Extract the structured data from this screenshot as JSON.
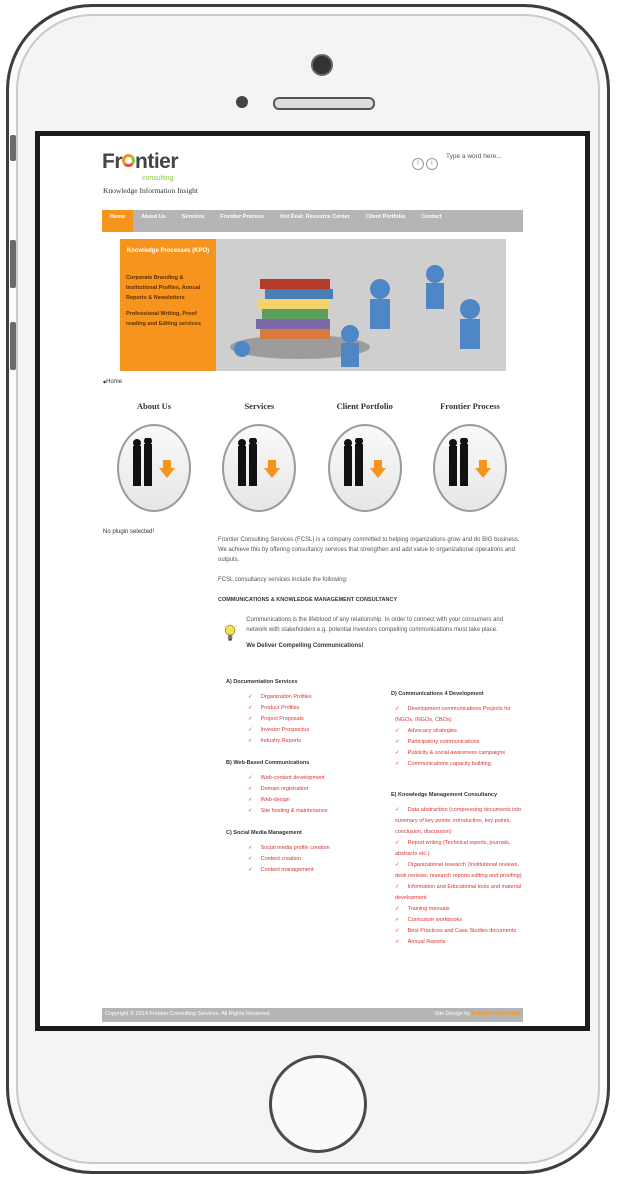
{
  "site": {
    "logo_main": "Fr",
    "logo_main_rest": "ntier",
    "logo_sub": "consulting",
    "tagline": "Knowledge Information Insight",
    "search_placeholder": "Type a word here..."
  },
  "nav": [
    "Home",
    "About Us",
    "Services",
    "Frontier Process",
    "Hot Deal: Resource Center",
    "Client Portfolio",
    "Contact"
  ],
  "banner": {
    "title": "Knowledge Processes (KPO)",
    "text1": "Corporate Branding & Institutional Profiles, Annual Reports & Newsletters",
    "text2": "Professional Writing, Proof reading and Editing services"
  },
  "breadcrumb": "Home",
  "columns": [
    {
      "title": "About Us"
    },
    {
      "title": "Services"
    },
    {
      "title": "Client Portfolio"
    },
    {
      "title": "Frontier Process"
    }
  ],
  "no_plugin": "No plugin selected!",
  "content": {
    "p1": "Frontier Consulting Services (FCSL) is a company committed to helping organizations grow and do BIG business. We achieve this by offering consultancy services that strengthen and add value to organizational operations and outputs.",
    "p2": "FCSL consultancy services include the following:",
    "heading": "COMMUNICATIONS & KNOWLEDGE MANAGEMENT CONSULTANCY",
    "p3": "Communications is the lifeblood of any relationship. In order to connect with your consumers and network with stakeholders e.g. potential investors compelling communications must take place.",
    "deliver": "We Deliver Compelling Communications!"
  },
  "sections_left": [
    {
      "heading": "A) Documentation Services",
      "items": [
        "Organization Profiles",
        "Product Profiles",
        "Project Proposals",
        "Investor Prospectus",
        "Industry Reports"
      ]
    },
    {
      "heading": "B) Web-Based Communications",
      "items": [
        "Web-content development",
        "Domain registration",
        "Web-design",
        "Site hosting & maintenance"
      ]
    },
    {
      "heading": "C) Social Media Management",
      "items": [
        "Social media profile creation",
        "Content creation",
        "Content management"
      ]
    }
  ],
  "sections_right": [
    {
      "heading": "D) Communications 4 Development",
      "items": [
        "Development communications Projects for (NGOs, INGOs, CBOs)",
        "Advocacy strategies",
        "Participatory communications",
        "Publicity & social awareness campaigns",
        "Communications capacity building."
      ]
    },
    {
      "heading": "E) Knowledge Management Consultancy",
      "items": [
        "Data abstraction (compressing documents into summary of key points: introduction, key points, conclusion, discussion)",
        "Report writing (Technical reports, journals, abstracts etc.)",
        "Organizational research (Institutional reviews, desk reviews, research reports editing and proofing)",
        "Information and Educational tools and material development",
        "Training manuals",
        "Curriculum workbooks",
        "Best Practices and Case Studies documents",
        "Annual Reports"
      ]
    }
  ],
  "footer": {
    "left": "Copyright © 2014 Frontier Consulting Services. All Rights Reserved.",
    "right_prefix": "Site Design by",
    "right_brand": "Kreative Koncepts"
  },
  "colors": {
    "accent": "#f7941d",
    "nav_bg": "#b5b5b5",
    "list": "#dd3333"
  }
}
